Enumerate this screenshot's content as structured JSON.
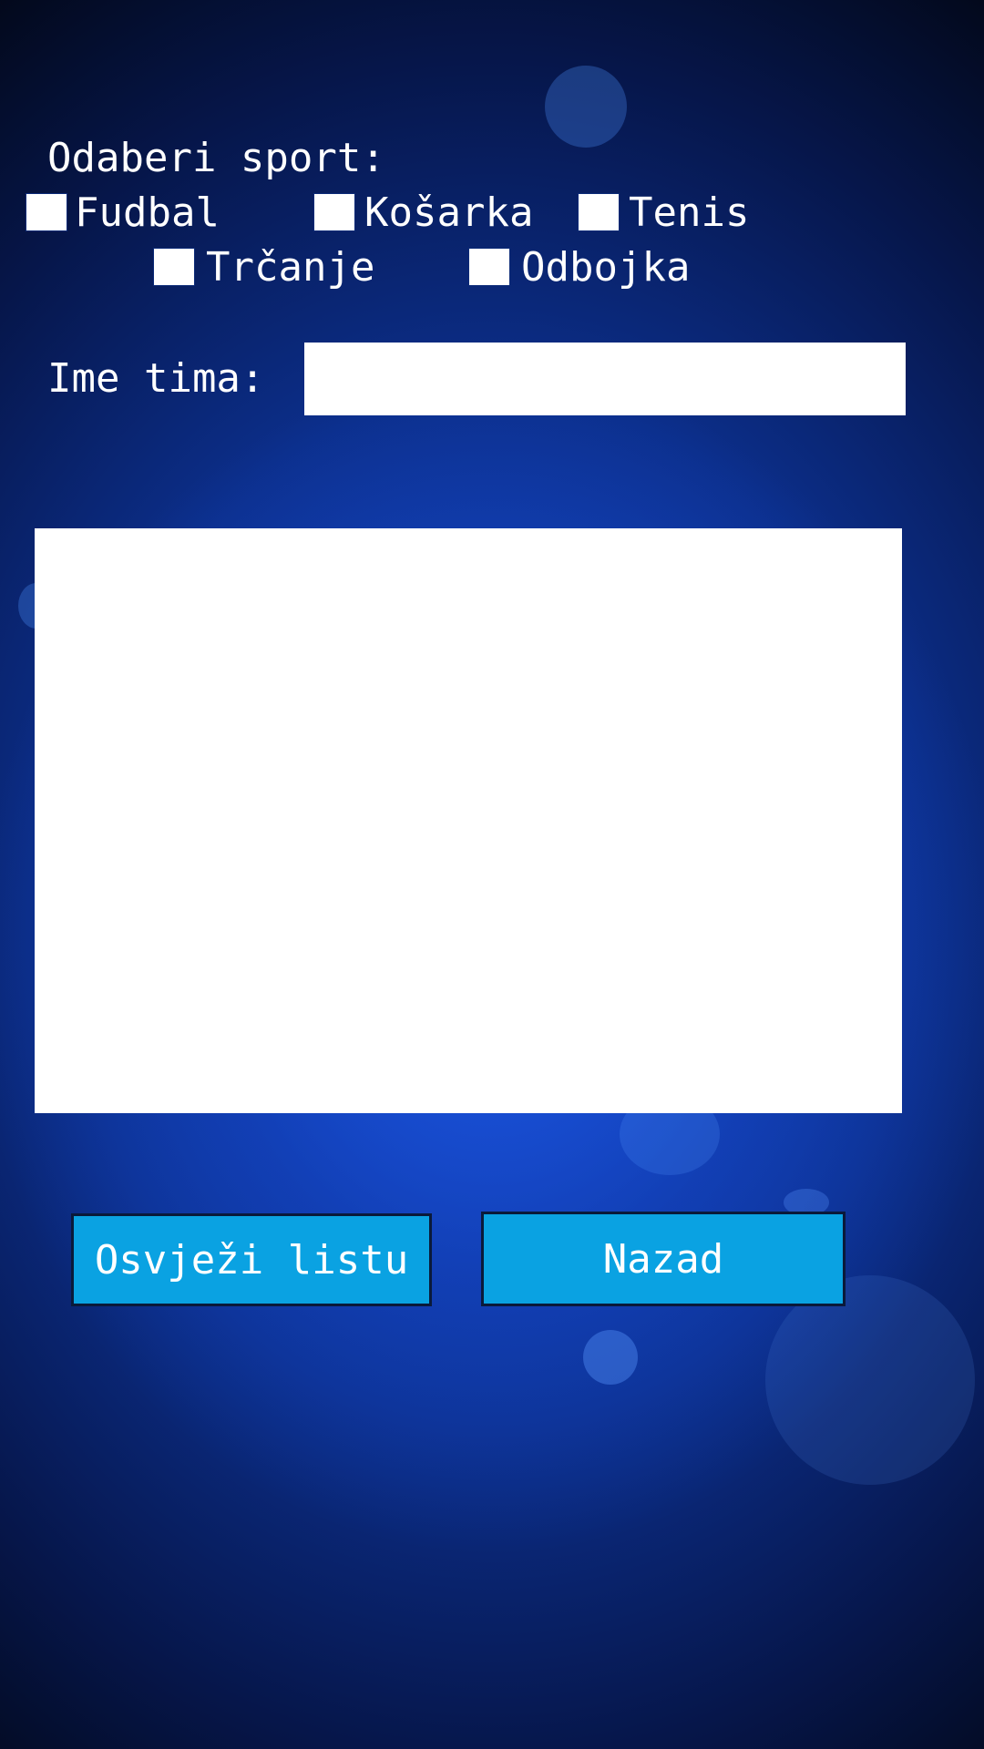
{
  "sport_section": {
    "title": "Odaberi sport:",
    "options": [
      {
        "label": "Fudbal",
        "checked": false
      },
      {
        "label": "Košarka",
        "checked": false
      },
      {
        "label": "Tenis",
        "checked": false
      },
      {
        "label": "Trčanje",
        "checked": false
      },
      {
        "label": "Odbojka",
        "checked": false
      }
    ]
  },
  "team": {
    "label": "Ime tima:",
    "value": "",
    "placeholder": ""
  },
  "team_list": {
    "items": []
  },
  "buttons": {
    "refresh_label": "Osvježi listu",
    "back_label": "Nazad"
  },
  "colors": {
    "button_bg": "#0aa2e2",
    "background_accent": "#1548c8"
  }
}
